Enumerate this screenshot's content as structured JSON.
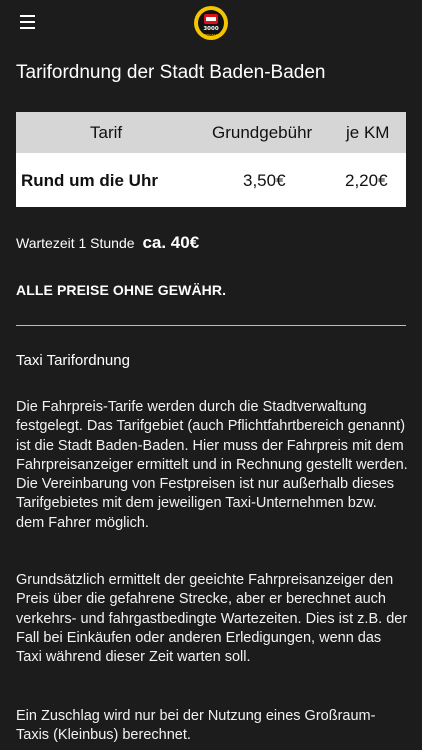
{
  "header": {
    "logo_text": "3000 Baden-Baden"
  },
  "page": {
    "title": "Tarifordnung der Stadt Baden-Baden"
  },
  "tariff_table": {
    "headers": [
      "Tarif",
      "Grundgebühr",
      "je KM"
    ],
    "rows": [
      {
        "name": "Rund um die Uhr",
        "base_fee": "3,50€",
        "per_km": "2,20€"
      }
    ]
  },
  "waiting": {
    "label": "Wartezeit 1 Stunde",
    "value": "ca. 40€"
  },
  "disclaimer": "ALLE PREISE OHNE GEWÄHR.",
  "section": {
    "heading": "Taxi Tarifordnung",
    "paragraphs": [
      "Die Fahrpreis-Tarife werden durch die Stadtverwaltung festgelegt. Das Tarifgebiet (auch Pflichtfahrtbereich genannt) ist die Stadt Baden-Baden. Hier muss der Fahrpreis mit dem Fahrpreisanzeiger ermittelt und in Rechnung gestellt werden. Die Vereinbarung von Festpreisen ist nur außerhalb dieses Tarifgebietes mit dem jeweiligen Taxi-Unternehmen bzw. dem Fahrer möglich.",
      "Grundsätzlich ermittelt der geeichte Fahrpreisanzeiger den Preis über die gefahrene Strecke, aber er berechnet auch verkehrs- und fahrgastbedingte Wartezeiten. Dies ist z.B. der Fall bei Einkäufen oder anderen Erledigungen, wenn das Taxi während dieser Zeit warten soll.",
      "Ein Zuschlag wird nur bei der Nutzung eines Großraum-Taxis (Kleinbus) berechnet."
    ]
  },
  "colors": {
    "background": "#1c1c1c",
    "table_header": "#d6d6d6",
    "logo_yellow": "#f5c400",
    "logo_red": "#d7141a"
  },
  "icons": {
    "menu": "hamburger-menu-icon"
  }
}
